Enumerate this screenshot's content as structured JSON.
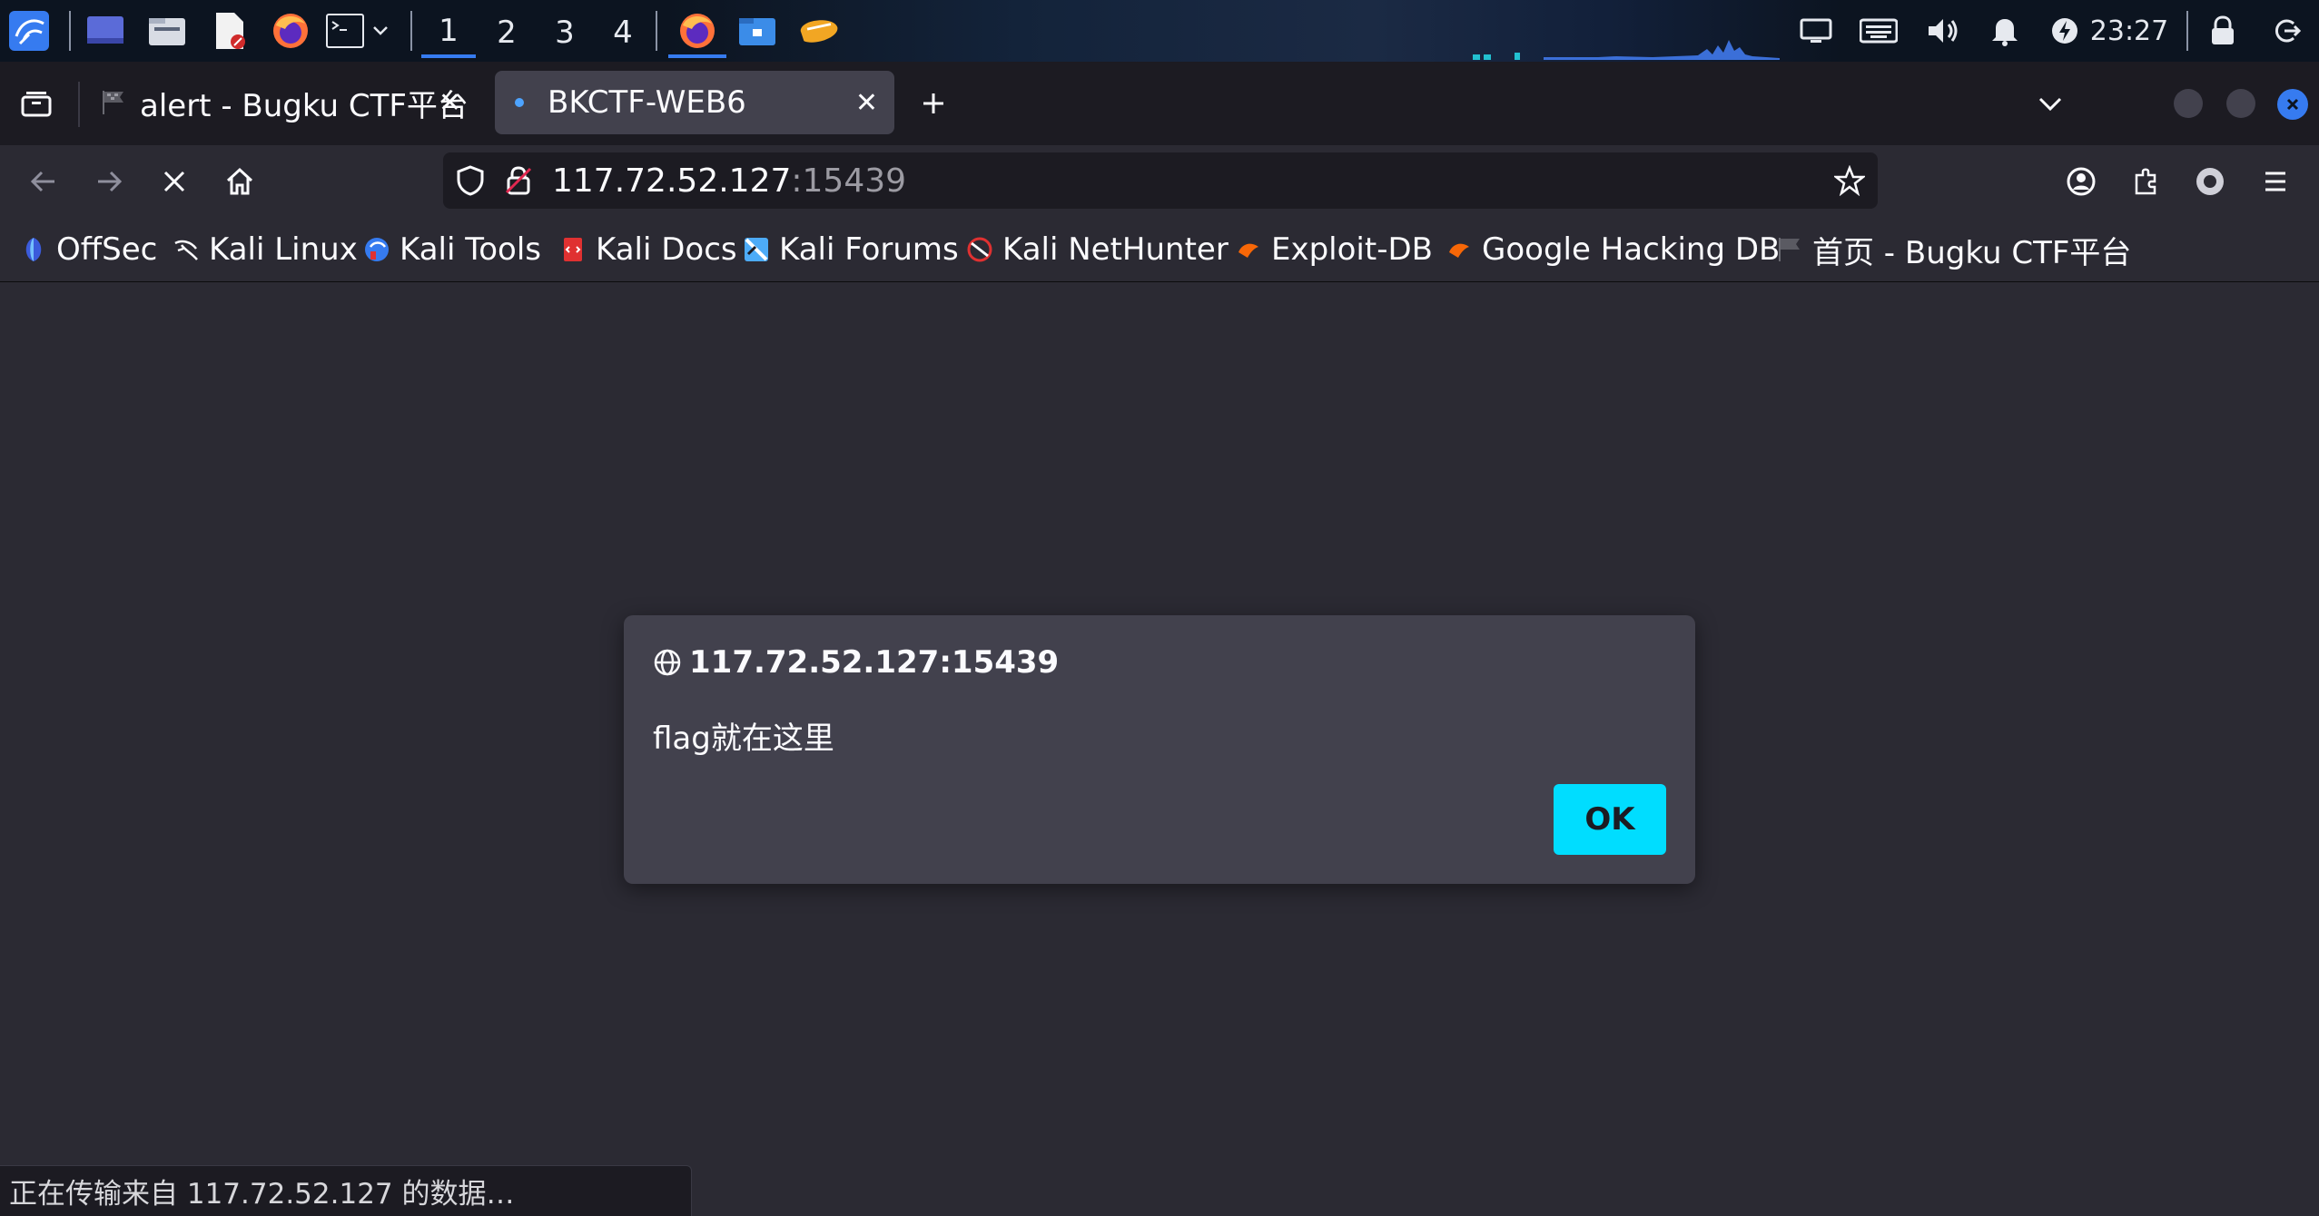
{
  "taskbar": {
    "workspaces": [
      "1",
      "2",
      "3",
      "4"
    ],
    "active_workspace": "1",
    "clock": "23:27",
    "icons": [
      "kali-menu-icon",
      "desktop-icon",
      "file-manager-icon",
      "text-editor-icon",
      "firefox-icon",
      "terminal-icon",
      "chevron-down-icon",
      "firefox-icon",
      "files-icon",
      "burpsuite-icon",
      "display-icon",
      "keyboard-icon",
      "volume-icon",
      "notification-bell-icon",
      "power-icon",
      "lock-icon",
      "logout-icon"
    ]
  },
  "tabs": [
    {
      "title": "alert - Bugku CTF平台",
      "active": false
    },
    {
      "title": "BKCTF-WEB6",
      "active": true
    }
  ],
  "navbar": {
    "url_host": "117.72.52.127",
    "url_port": ":15439"
  },
  "bookmarks": [
    {
      "label": "OffSec",
      "icon": "offsec-icon"
    },
    {
      "label": "Kali Linux",
      "icon": "kali-dragon-icon"
    },
    {
      "label": "Kali Tools",
      "icon": "kali-tools-icon"
    },
    {
      "label": "Kali Docs",
      "icon": "kali-docs-icon"
    },
    {
      "label": "Kali Forums",
      "icon": "kali-forums-icon"
    },
    {
      "label": "Kali NetHunter",
      "icon": "nethunter-icon"
    },
    {
      "label": "Exploit-DB",
      "icon": "exploit-db-icon"
    },
    {
      "label": "Google Hacking DB",
      "icon": "ghdb-icon"
    },
    {
      "label": "首页 - Bugku CTF平台",
      "icon": "flag-icon"
    }
  ],
  "dialog": {
    "origin": "117.72.52.127:15439",
    "message": "flag就在这里",
    "ok_label": "OK"
  },
  "status": "正在传输来自 117.72.52.127 的数据…",
  "colors": {
    "accent": "#00ddff",
    "tab_bar": "#1c1b22",
    "toolbar": "#2b2a33",
    "dialog": "#42414d",
    "taskbar": "#0c1420"
  }
}
